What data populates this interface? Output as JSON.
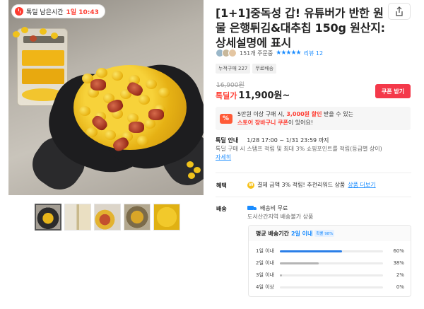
{
  "deal_badge": {
    "label": "톡딜 남은시간",
    "time": "1일 10:43"
  },
  "product": {
    "title": "[1+1]중독성 갑! 유튜버가 반한 원물 은행튀김&대추칩 150g 원산지: 상세설명에 표시",
    "buyers": "151개 주문중",
    "rating_stars": "★★★★★",
    "review_link": "리뷰 12",
    "tags": [
      "누적구매 227",
      "무료배송"
    ]
  },
  "price": {
    "original": "16,900원",
    "deal_label": "톡딜가",
    "current": "11,900원~",
    "coupon_button": "쿠폰 받기"
  },
  "promo": {
    "line1_pre": "5만원 이상 구매 시,",
    "line1_hl": "3,000원 할인",
    "line1_post": "받을 수 있는",
    "line2_hl": "스토어 장바구니 쿠폰",
    "line2_post": "이 있어요!"
  },
  "deal_info": {
    "label": "톡딜 안내",
    "period": "1/28 17:00 ~ 1/31 23:59 까지",
    "desc": "톡딜 구매 시 스탬프 적립 및 최대 3% 쇼핑포인트를 적립(등급별 상이)",
    "more": "자세히"
  },
  "benefit": {
    "label": "혜택",
    "text": "결제 금액 3% 적립! 추천리워드 상품",
    "link": "상품 더보기"
  },
  "shipping": {
    "label": "배송",
    "fee": "배송비 무료",
    "sub": "도서산간지역 배송불가 상품",
    "dist_title_pre": "평균 배송기간",
    "dist_title_hl": "2일 이내",
    "dist_chip": "확률 98%",
    "rows": [
      {
        "label": "1일 이내",
        "pct": "60%",
        "value": 0.6,
        "highlight": true
      },
      {
        "label": "2일 이내",
        "pct": "38%",
        "value": 0.38,
        "highlight": false
      },
      {
        "label": "3일 이내",
        "pct": "2%",
        "value": 0.02,
        "highlight": false
      },
      {
        "label": "4일 이상",
        "pct": "0%",
        "value": 0.0,
        "highlight": false
      }
    ]
  },
  "colors": {
    "accent_red": "#f4394a",
    "link_blue": "#1a8cff",
    "bar_blue": "#2b7fe8"
  },
  "icons": [
    "clock-icon",
    "share-icon",
    "promo-icon",
    "coin-icon",
    "truck-icon"
  ]
}
